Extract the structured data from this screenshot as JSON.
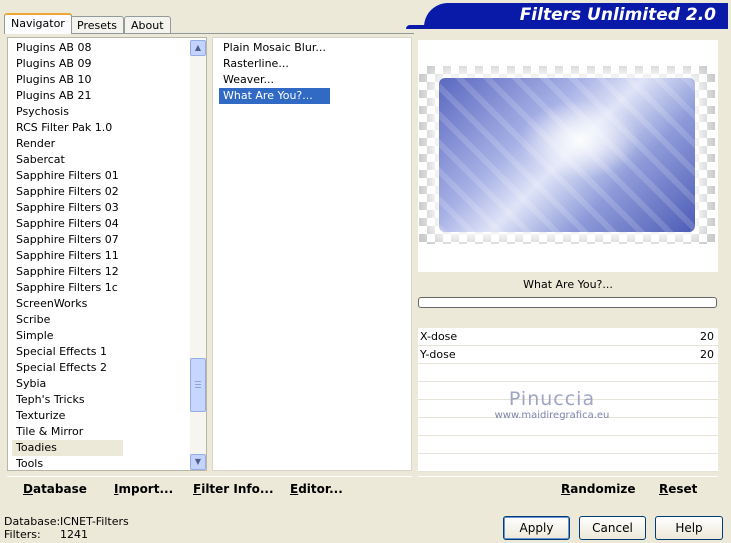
{
  "tabs": [
    {
      "label": "Navigator",
      "active": true
    },
    {
      "label": "Presets",
      "active": false
    },
    {
      "label": "About",
      "active": false
    }
  ],
  "banner": {
    "title": "Filters Unlimited 2.0"
  },
  "categories": [
    "Plugins AB 08",
    "Plugins AB 09",
    "Plugins AB 10",
    "Plugins AB 21",
    "Psychosis",
    "RCS Filter Pak 1.0",
    "Render",
    "Sabercat",
    "Sapphire Filters 01",
    "Sapphire Filters 02",
    "Sapphire Filters 03",
    "Sapphire Filters 04",
    "Sapphire Filters 07",
    "Sapphire Filters 11",
    "Sapphire Filters 12",
    "Sapphire Filters 1c",
    "ScreenWorks",
    "Scribe",
    "Simple",
    "Special Effects 1",
    "Special Effects 2",
    "Sybia",
    "Teph's Tricks",
    "Texturize",
    "Tile & Mirror",
    "Toadies",
    "Tools"
  ],
  "selected_category": "Toadies",
  "filters": [
    "Plain Mosaic Blur...",
    "Rasterline...",
    "Weaver...",
    "What Are You?..."
  ],
  "selected_filter": "What Are You?...",
  "preview": {
    "filter_name": "What Are You?...",
    "progress": 0
  },
  "params": [
    {
      "label": "X-dose",
      "value": "20"
    },
    {
      "label": "Y-dose",
      "value": "20"
    }
  ],
  "watermark": {
    "name": "Pinuccia",
    "site": "www.maidiregrafica.eu"
  },
  "toolbar_left": [
    {
      "label": "Database",
      "accel": "D"
    },
    {
      "label": "Import...",
      "accel": "I"
    },
    {
      "label": "Filter Info...",
      "accel": "F"
    },
    {
      "label": "Editor...",
      "accel": "E"
    }
  ],
  "toolbar_right": [
    {
      "label": "Randomize",
      "accel": "R"
    },
    {
      "label": "Reset",
      "accel": "R"
    }
  ],
  "status": {
    "database_label": "Database:",
    "database_value": "ICNET-Filters",
    "filters_label": "Filters:",
    "filters_value": "1241"
  },
  "buttons": {
    "apply": "Apply",
    "cancel": "Cancel",
    "help": "Help"
  },
  "icons": {
    "scroll_up": "chevron-up-icon",
    "scroll_down": "chevron-down-icon"
  }
}
